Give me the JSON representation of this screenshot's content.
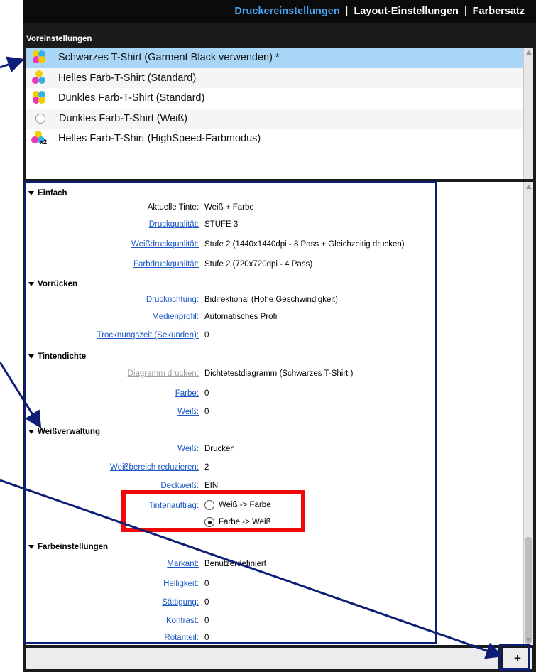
{
  "topnav": {
    "tabs": [
      {
        "label": "Druckereinstellungen",
        "active": true
      },
      {
        "label": "Layout-Einstellungen",
        "active": false
      },
      {
        "label": "Farbersatz",
        "active": false
      }
    ],
    "separator": "|"
  },
  "presets": {
    "title": "Voreinstellungen",
    "items": [
      {
        "label": "Schwarzes T-Shirt (Garment Black verwenden) *",
        "icon": "cmyk-dots-icon",
        "selected": true
      },
      {
        "label": "Helles Farb-T-Shirt (Standard)",
        "icon": "color-dots-icon",
        "selected": false
      },
      {
        "label": "Dunkles Farb-T-Shirt (Standard)",
        "icon": "cmyk-dots-icon",
        "selected": false
      },
      {
        "label": "Dunkles Farb-T-Shirt (Weiß)",
        "icon": "white-circle-icon",
        "selected": false
      },
      {
        "label": "Helles Farb-T-Shirt (HighSpeed-Farbmodus)",
        "icon": "highspeed-dots-icon",
        "icon_text": "x2",
        "selected": false
      }
    ]
  },
  "settings": {
    "einfach": {
      "title": "Einfach",
      "aktuelle_tinte": {
        "label": "Aktuelle Tinte:",
        "value": "Weiß + Farbe"
      },
      "druckqualitaet": {
        "label": "Druckqualität:",
        "value": "STUFE 3"
      },
      "weissdruckqualitaet": {
        "label": "Weißdruckqualität:",
        "value": "Stufe 2 (1440x1440dpi - 8 Pass + Gleichzeitig drucken)"
      },
      "farbdruckqualitaet": {
        "label": "Farbdruckqualität:",
        "value": "Stufe 2 (720x720dpi - 4 Pass)"
      }
    },
    "vorruecken": {
      "title": "Vorrücken",
      "druckrichtung": {
        "label": "Druckrichtung:",
        "value": "Bidirektional (Hohe Geschwindigkeit)"
      },
      "medienprofil": {
        "label": "Medienprofil:",
        "value": "Automatisches Profil"
      },
      "trocknungszeit": {
        "label": "Trocknungszeit (Sekunden):",
        "value": "0"
      }
    },
    "tintendichte": {
      "title": "Tintendichte",
      "diagramm": {
        "label": "Diagramm drucken:",
        "value": "Dichtetestdiagramm (Schwarzes T-Shirt )"
      },
      "farbe": {
        "label": "Farbe:",
        "value": "0"
      },
      "weiss": {
        "label": "Weiß:",
        "value": "0"
      }
    },
    "weissverwaltung": {
      "title": "Weißverwaltung",
      "weiss": {
        "label": "Weiß:",
        "value": "Drucken"
      },
      "weissbereich": {
        "label": "Weißbereich reduzieren:",
        "value": "2"
      },
      "deckweiss": {
        "label": "Deckweiß:",
        "value": "EIN"
      },
      "tintenauftrag": {
        "label": "Tintenauftrag:",
        "options": [
          {
            "label": "Weiß -> Farbe",
            "checked": false
          },
          {
            "label": "Farbe -> Weiß",
            "checked": true
          }
        ]
      }
    },
    "farbeinstellungen": {
      "title": "Farbeinstellungen",
      "markant": {
        "label": "Markant:",
        "value": "Benutzerdefiniert"
      },
      "helligkeit": {
        "label": "Helligkeit:",
        "value": "0"
      },
      "saettigung": {
        "label": "Sättigung:",
        "value": "0"
      },
      "kontrast": {
        "label": "Kontrast:",
        "value": "0"
      },
      "rotanteil": {
        "label": "Rotanteil:",
        "value": "0"
      }
    }
  },
  "bottom": {
    "add_label": "+"
  },
  "colors": {
    "active_tab": "#4aa3ee",
    "link": "#1b57c6",
    "selected_row": "#a9d6f6",
    "annotation_blue": "#0e1e77",
    "annotation_red": "#ee0a0a"
  }
}
